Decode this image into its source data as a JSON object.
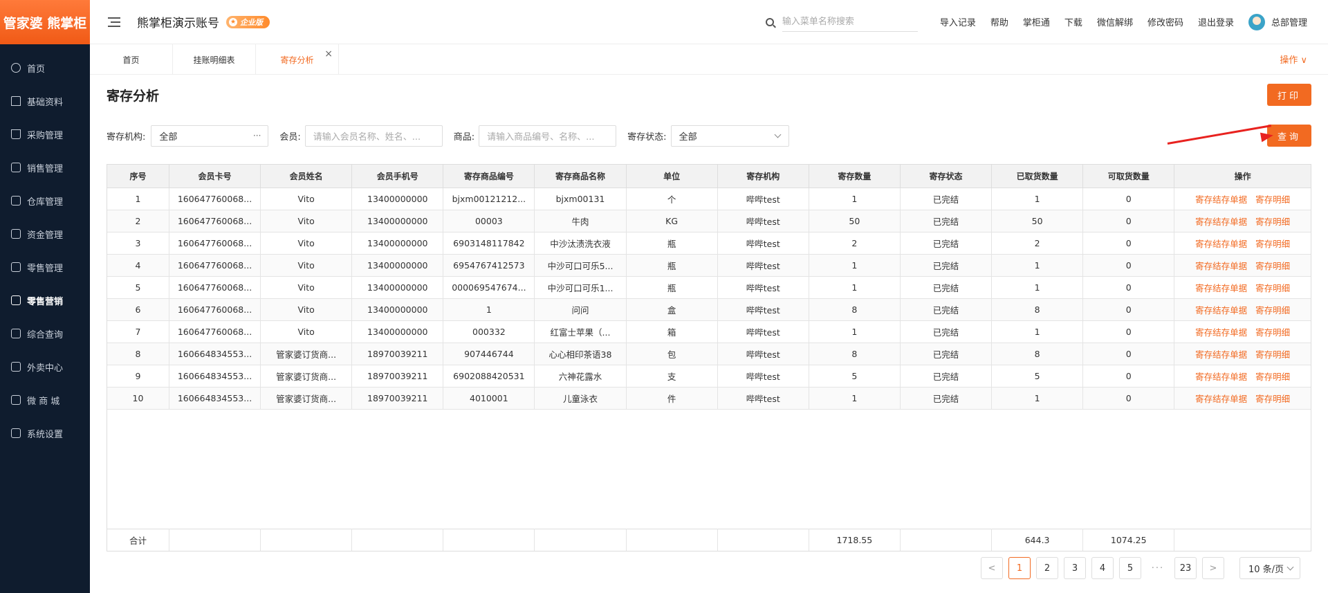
{
  "brand": {
    "logo_text": "管家婆 熊掌柜"
  },
  "sidebar": {
    "items": [
      {
        "label": "首页",
        "icon": "globe-icon",
        "active": false
      },
      {
        "label": "基础资料",
        "icon": "home-icon",
        "active": false
      },
      {
        "label": "采购管理",
        "icon": "cart-icon",
        "active": false
      },
      {
        "label": "销售管理",
        "icon": "sales-icon",
        "active": false
      },
      {
        "label": "仓库管理",
        "icon": "warehouse-icon",
        "active": false
      },
      {
        "label": "资金管理",
        "icon": "fund-icon",
        "active": false
      },
      {
        "label": "零售管理",
        "icon": "chart-icon",
        "active": false
      },
      {
        "label": "零售营销",
        "icon": "gift-icon",
        "active": true
      },
      {
        "label": "综合查询",
        "icon": "bar-chart-icon",
        "active": false
      },
      {
        "label": "外卖中心",
        "icon": "delivery-icon",
        "active": false
      },
      {
        "label": "微 商 城",
        "icon": "shop-bag-icon",
        "active": false
      },
      {
        "label": "系统设置",
        "icon": "gear-icon",
        "active": false
      }
    ]
  },
  "header": {
    "account_name": "熊掌柜演示账号",
    "badge": "企业版",
    "search_placeholder": "输入菜单名称搜索",
    "links": [
      "导入记录",
      "帮助",
      "掌柜通",
      "下载",
      "微信解绑",
      "修改密码",
      "退出登录"
    ],
    "user_name": "总部管理"
  },
  "tabs": {
    "items": [
      {
        "label": "首页",
        "active": false
      },
      {
        "label": "挂账明细表",
        "active": false
      },
      {
        "label": "寄存分析",
        "active": true
      }
    ],
    "ops_label": "操作 ∨"
  },
  "page": {
    "title": "寄存分析",
    "print_label": "打印",
    "query_label": "查询"
  },
  "filters": {
    "org_label": "寄存机构:",
    "org_value": "全部",
    "member_label": "会员:",
    "member_placeholder": "请输入会员名称、姓名、...",
    "goods_label": "商品:",
    "goods_placeholder": "请输入商品编号、名称、...",
    "status_label": "寄存状态:",
    "status_value": "全部"
  },
  "table": {
    "columns": [
      "序号",
      "会员卡号",
      "会员姓名",
      "会员手机号",
      "寄存商品编号",
      "寄存商品名称",
      "单位",
      "寄存机构",
      "寄存数量",
      "寄存状态",
      "已取货数量",
      "可取货数量",
      "操作"
    ],
    "op_labels": [
      "寄存结存单据",
      "寄存明细"
    ],
    "rows": [
      [
        "1",
        "160647760068...",
        "Vito",
        "13400000000",
        "bjxm00121212...",
        "bjxm00131",
        "个",
        "哔哔test",
        "1",
        "已完结",
        "1",
        "0"
      ],
      [
        "2",
        "160647760068...",
        "Vito",
        "13400000000",
        "00003",
        "牛肉",
        "KG",
        "哔哔test",
        "50",
        "已完结",
        "50",
        "0"
      ],
      [
        "3",
        "160647760068...",
        "Vito",
        "13400000000",
        "6903148117842",
        "中沙汰渍洗衣液",
        "瓶",
        "哔哔test",
        "2",
        "已完结",
        "2",
        "0"
      ],
      [
        "4",
        "160647760068...",
        "Vito",
        "13400000000",
        "6954767412573",
        "中沙可口可乐5...",
        "瓶",
        "哔哔test",
        "1",
        "已完结",
        "1",
        "0"
      ],
      [
        "5",
        "160647760068...",
        "Vito",
        "13400000000",
        "000069547674...",
        "中沙可口可乐1...",
        "瓶",
        "哔哔test",
        "1",
        "已完结",
        "1",
        "0"
      ],
      [
        "6",
        "160647760068...",
        "Vito",
        "13400000000",
        "1",
        "问问",
        "盒",
        "哔哔test",
        "8",
        "已完结",
        "8",
        "0"
      ],
      [
        "7",
        "160647760068...",
        "Vito",
        "13400000000",
        "000332",
        "红富士苹果（...",
        "箱",
        "哔哔test",
        "1",
        "已完结",
        "1",
        "0"
      ],
      [
        "8",
        "160664834553...",
        "管家婆订货商...",
        "18970039211",
        "907446744",
        "心心相印茶语38",
        "包",
        "哔哔test",
        "8",
        "已完结",
        "8",
        "0"
      ],
      [
        "9",
        "160664834553...",
        "管家婆订货商...",
        "18970039211",
        "6902088420531",
        "六神花露水",
        "支",
        "哔哔test",
        "5",
        "已完结",
        "5",
        "0"
      ],
      [
        "10",
        "160664834553...",
        "管家婆订货商...",
        "18970039211",
        "4010001",
        "儿童泳衣",
        "件",
        "哔哔test",
        "1",
        "已完结",
        "1",
        "0"
      ]
    ],
    "footer": [
      "合计",
      "",
      "",
      "",
      "",
      "",
      "",
      "",
      "1718.55",
      "",
      "644.3",
      "1074.25",
      ""
    ]
  },
  "pagination": {
    "pages": [
      "1",
      "2",
      "3",
      "4",
      "5"
    ],
    "dots": "···",
    "last": "23",
    "current": "1",
    "prev": "<",
    "next": ">",
    "page_size": "10 条/页"
  },
  "colors": {
    "accent": "#f26a21",
    "sidebar_bg": "#0f1c2e",
    "arrow": "#e8221f"
  }
}
